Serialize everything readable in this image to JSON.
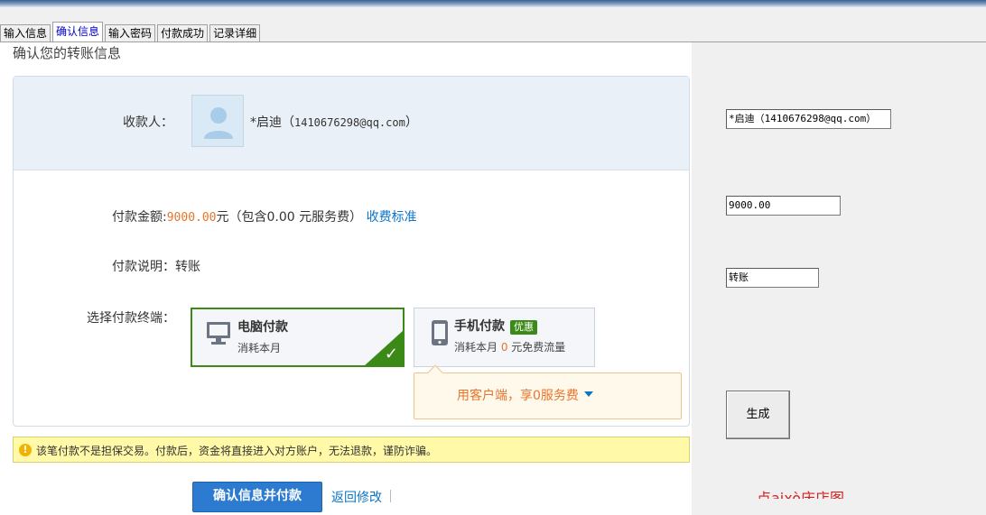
{
  "tabs": [
    "输入信息",
    "确认信息",
    "输入密码",
    "付款成功",
    "记录详细"
  ],
  "main": {
    "title": "确认您的转账信息",
    "payee_label": "收款人：",
    "payee_name_prefix": "*启迪（",
    "payee_email": "1410676298@qq.com",
    "payee_name_suffix": "）",
    "amount_label": "付款金额:",
    "amount_value": "9000.00",
    "amount_unit": "元（包含0.00 元服务费）",
    "fee_link": "收费标准",
    "memo_label": "付款说明：",
    "memo_value": "转账",
    "terminal_label": "选择付款终端：",
    "pc_option": {
      "title": "电脑付款",
      "sub": "消耗本月"
    },
    "mobile_option": {
      "title": "手机付款",
      "badge": "优惠",
      "sub_prefix": "消耗本月 ",
      "sub_value": "0",
      "sub_suffix": " 元免费流量"
    },
    "promo_text": "用客户端，享0服务费",
    "warning": "该笔付款不是担保交易。付款后，资金将直接进入对方账户，无法退款，谨防诈骗。",
    "confirm_button": "确认信息并付款",
    "back_link": "返回修改"
  },
  "side": {
    "payee_value": "*启迪（1410676298@qq.com）",
    "amount_value": "9000.00",
    "memo_value": "转账",
    "generate_button": "生成",
    "red_text": "点això庆店图"
  },
  "colors": {
    "accent": "#0a75c9",
    "amount": "#e8742b",
    "selected": "#3b8a17"
  },
  "icons": [
    "user-avatar-icon",
    "monitor-icon",
    "phone-icon",
    "checkmark-icon",
    "warning-icon",
    "caret-down-icon"
  ]
}
